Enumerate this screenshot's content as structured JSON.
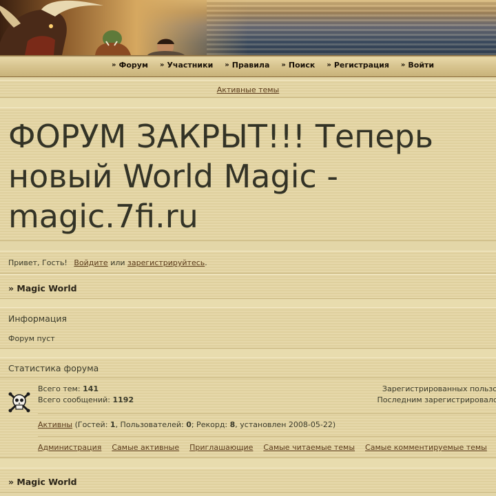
{
  "nav": {
    "items": [
      {
        "label": "Форум"
      },
      {
        "label": "Участники"
      },
      {
        "label": "Правила"
      },
      {
        "label": "Поиск"
      },
      {
        "label": "Регистрация"
      },
      {
        "label": "Войти"
      }
    ]
  },
  "active_topics_link": "Активные темы",
  "forum_title": "ФОРУМ ЗАКРЫТ!!! Теперь новый World Magic - magic.7fi.ru",
  "welcome": {
    "greeting": "Привет, Гость!",
    "login_link": "Войдите",
    "or_text": "или",
    "register_link": "зарегистрируйтесь",
    "end": "."
  },
  "category1": "» Magic World",
  "info": {
    "heading": "Информация",
    "text": "Форум пуст"
  },
  "stats": {
    "heading": "Статистика форума",
    "topics_label": "Всего тем:",
    "topics_value": "141",
    "posts_label": "Всего сообщений:",
    "posts_value": "1192",
    "registered_text": "Зарегистрированных пользо",
    "last_registered_text": "Последним зарегистрировалс",
    "online_link": "Активны",
    "online_guests_label": "(Гостей:",
    "guests_value": "1",
    "users_label": ", Пользователей:",
    "users_value": "0",
    "record_label": "; Рекорд:",
    "record_value": "8",
    "record_date": ", установлен 2008-05-22)",
    "links": [
      {
        "label": "Администрация"
      },
      {
        "label": "Самые активные"
      },
      {
        "label": "Приглашающие"
      },
      {
        "label": "Самые читаемые темы"
      },
      {
        "label": "Самые комментируемые темы"
      }
    ]
  },
  "category2": "» Magic World",
  "colors": {
    "background": "#e3d6a8",
    "link": "#5a3a1a",
    "text": "#3a3a2a"
  }
}
